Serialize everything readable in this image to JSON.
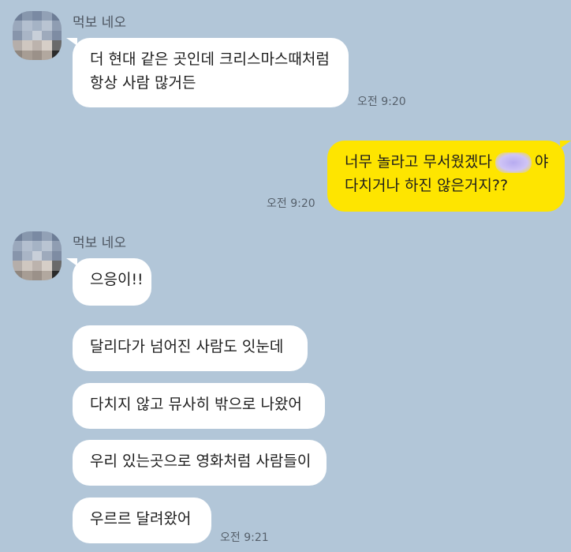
{
  "chat": {
    "sender_name": "먹보 네오",
    "messages": [
      {
        "lines": [
          "더 현대 같은 곳인데 크리스마스때처럼",
          "항상 사람 많거든"
        ],
        "time": "오전 9:20"
      },
      {
        "lines_before": "너무 놀라고 무서웠겠다",
        "lines_after": "야",
        "line2": "다치거나 하진 않은거지??",
        "time": "오전 9:20"
      },
      {
        "text": "으응이!!"
      },
      {
        "text": "달리다가 넘어진 사람도 잇눈데"
      },
      {
        "text": "다치지 않고 뮤사히 밖으로 나왔어"
      },
      {
        "text": "우리 있는곳으로 영화처럼 사람들이"
      },
      {
        "text": "우르르 달려왔어",
        "time": "오전 9:21"
      }
    ]
  },
  "colors": {
    "background": "#b2c6d8",
    "incoming_bubble": "#ffffff",
    "outgoing_bubble": "#fee500"
  },
  "icons": {
    "avatar": "pixelated-profile-avatar"
  }
}
